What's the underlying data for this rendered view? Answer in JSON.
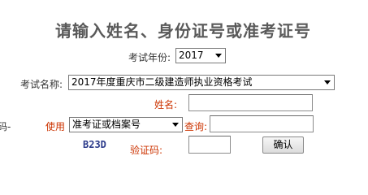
{
  "title": "请输入姓名、身份证号或准考证号",
  "year": {
    "label": "考试年份:",
    "selected": "2017"
  },
  "exam": {
    "label": "考试名称:",
    "selected": "2017年度重庆市二级建造师执业资格考试"
  },
  "name": {
    "label": "姓名:",
    "value": ""
  },
  "query": {
    "edge_text": "码-",
    "use_label": "使用",
    "type_selected": "准考证或档案号",
    "query_label": "查询:",
    "value": ""
  },
  "captcha": {
    "image_text": "B23D",
    "label": "验证码:",
    "value": ""
  },
  "buttons": {
    "confirm": "确认"
  }
}
